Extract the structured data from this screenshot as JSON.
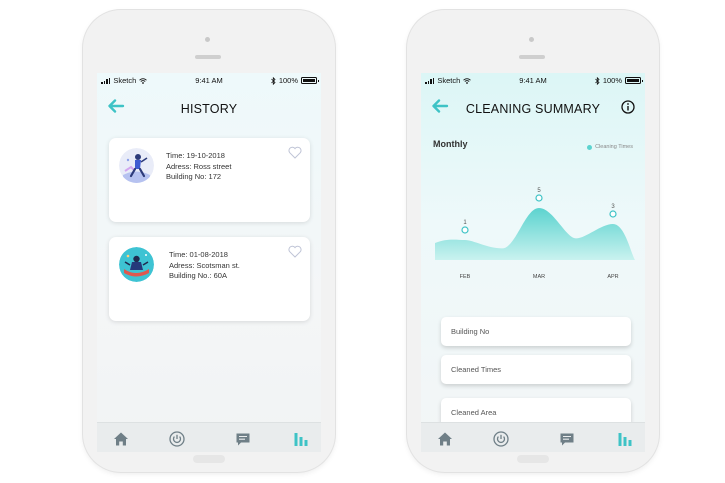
{
  "status_bar": {
    "carrier": "Sketch",
    "time": "9:41 AM",
    "battery": "100%"
  },
  "history_screen": {
    "title": "HISTORY",
    "cards": [
      {
        "time": "Time: 19-10-2018",
        "address": "Adress: Ross street",
        "building": "Building No: 172"
      },
      {
        "time": "Time: 01-08-2018",
        "address": "Adress: Scotsman st.",
        "building": "Building No.: 60A"
      }
    ]
  },
  "summary_screen": {
    "title": "CLEANING SUMMARY",
    "chart_title": "Monthly",
    "fields": [
      {
        "label": "Building No"
      },
      {
        "label": "Cleaned Times"
      },
      {
        "label": "Cleaned Area"
      }
    ]
  },
  "chart_data": {
    "type": "area",
    "title": "Monthly",
    "categories": [
      "FEB",
      "MAR",
      "APR"
    ],
    "series": [
      {
        "name": "Cleaning Times",
        "values": [
          1,
          5,
          3
        ]
      }
    ],
    "data_labels": [
      "1",
      "5",
      "3"
    ],
    "color": "#5cd3cf",
    "grid": false,
    "legend_position": "top-right"
  },
  "tabbar": {
    "items": [
      {
        "icon": "home-icon"
      },
      {
        "icon": "power-icon"
      },
      {
        "icon": "chat-icon"
      },
      {
        "icon": "bar-chart-icon"
      }
    ],
    "active_color": "#3ec3c6",
    "inactive_color": "#6f7f87"
  },
  "colors": {
    "accent": "#3ec3c6",
    "chart_fill": "#5cd3cf"
  }
}
